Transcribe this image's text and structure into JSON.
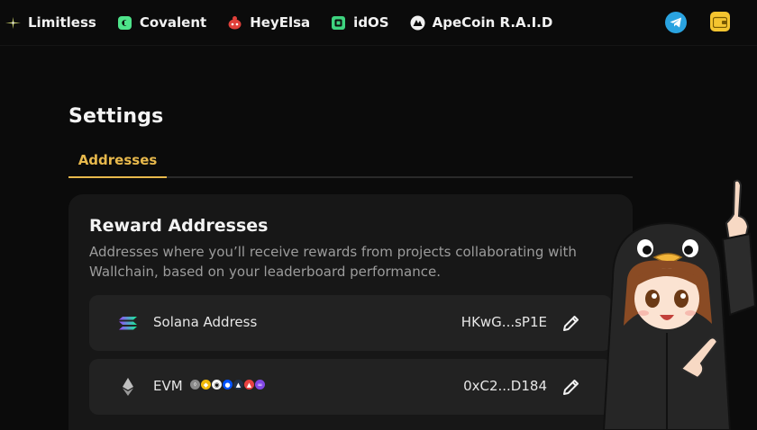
{
  "nav": {
    "items": [
      {
        "label": "Limitless",
        "icon": "sparkle-icon"
      },
      {
        "label": "Covalent",
        "icon": "covalent-icon"
      },
      {
        "label": "HeyElsa",
        "icon": "elsa-icon"
      },
      {
        "label": "idOS",
        "icon": "idos-icon"
      },
      {
        "label": "ApeCoin R.A.I.D",
        "icon": "apecoin-icon"
      }
    ],
    "telegram_icon": "telegram-icon",
    "wallet_icon": "wallet-icon"
  },
  "page": {
    "title": "Settings",
    "tabs": [
      {
        "label": "Addresses",
        "active": true
      }
    ]
  },
  "card": {
    "title": "Reward Addresses",
    "description": "Addresses where you’ll receive rewards from projects collaborating with Wallchain, based on your leaderboard performance.",
    "rows": [
      {
        "label": "Solana Address",
        "value": "HKwG...sP1E",
        "icon": "solana-icon"
      },
      {
        "label": "EVM",
        "value": "0xC2...D184",
        "icon": "ethereum-icon"
      }
    ]
  },
  "colors": {
    "accent": "#e8b94c",
    "background": "#0b0b0b",
    "card": "#171717",
    "row": "#222222",
    "telegram": "#2aa3e0",
    "wallet": "#f4c430"
  }
}
